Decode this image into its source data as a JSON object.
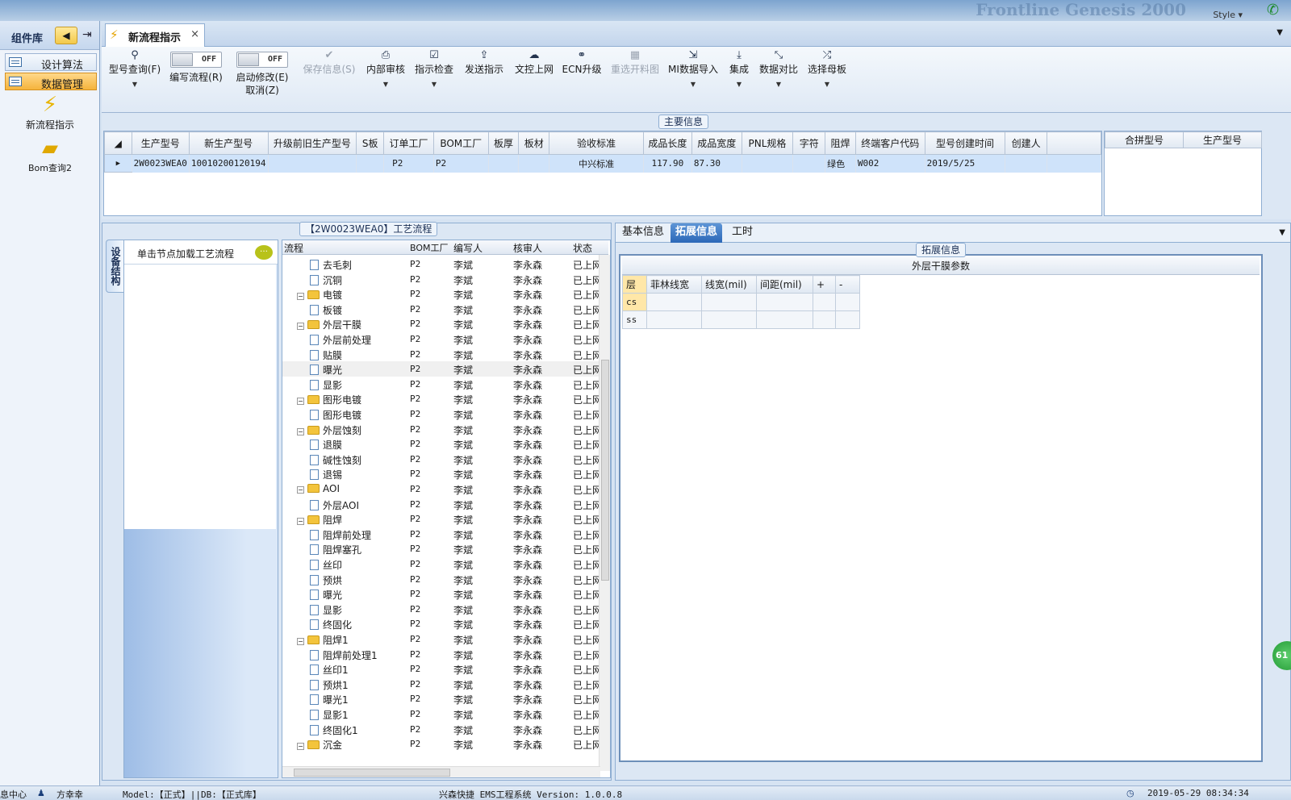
{
  "topstrip": {
    "brand": "Frontline  Genesis 2000",
    "style_label": "Style"
  },
  "left_panel": {
    "title": "组件库",
    "items": [
      {
        "label": "设计算法",
        "active": false
      },
      {
        "label": "数据管理",
        "active": true
      }
    ],
    "tools": [
      {
        "label": "新流程指示",
        "icon": "lightning-icon"
      },
      {
        "label": "Bom查询2",
        "icon": "folder-open-icon"
      }
    ]
  },
  "doc_tab": {
    "label": "新流程指示",
    "close": "×"
  },
  "ribbon": {
    "query": {
      "label": "型号查询(F)"
    },
    "write_flow": {
      "toggle": "OFF",
      "label": "编写流程(R)"
    },
    "start_edit": {
      "toggle": "OFF",
      "label": "启动修改(E)",
      "label2": "取消(Z)"
    },
    "buttons": [
      {
        "label": "保存信息(S)",
        "disabled": true
      },
      {
        "label": "内部审核",
        "disabled": false
      },
      {
        "label": "指示检查",
        "disabled": false
      },
      {
        "label": "发送指示",
        "disabled": false
      },
      {
        "label": "文控上网",
        "disabled": false
      },
      {
        "label": "ECN升级",
        "disabled": false
      },
      {
        "label": "重选开料图",
        "disabled": true
      },
      {
        "label": "MI数据导入",
        "disabled": false
      },
      {
        "label": "集成",
        "disabled": false
      },
      {
        "label": "数据对比",
        "disabled": false
      },
      {
        "label": "选择母板",
        "disabled": false
      }
    ]
  },
  "main_info": {
    "caption": "主要信息",
    "columns": [
      "生产型号",
      "新生产型号",
      "升级前旧生产型号",
      "S板",
      "订单工厂",
      "BOM工厂",
      "板厚",
      "板材",
      "验收标准",
      "成品长度",
      "成品宽度",
      "PNL规格",
      "字符",
      "阻焊",
      "终端客户代码",
      "型号创建时间",
      "创建人"
    ],
    "row": [
      "2W0023WEA0",
      "10010200120194",
      "",
      "",
      "P2",
      "P2",
      "",
      "",
      "中兴标准",
      "117.90",
      "87.30",
      "",
      "",
      "绿色",
      "W002",
      "2019/5/25",
      ""
    ],
    "side_columns": [
      "合拼型号",
      "生产型号"
    ]
  },
  "process": {
    "caption": "【2W0023WEA0】工艺流程",
    "vtab": "设备结构",
    "device_label": "单击节点加载工艺流程",
    "headers": [
      "流程",
      "BOM工厂",
      "编写人",
      "核审人",
      "状态"
    ],
    "rows": [
      {
        "name": "去毛刺",
        "level": 2,
        "folder": false,
        "bom": "P2",
        "writer": "李斌",
        "reviewer": "李永森",
        "status": "已上网"
      },
      {
        "name": "沉铜",
        "level": 2,
        "folder": false,
        "bom": "P2",
        "writer": "李斌",
        "reviewer": "李永森",
        "status": "已上网"
      },
      {
        "name": "电镀",
        "level": 1,
        "folder": true,
        "bom": "P2",
        "writer": "李斌",
        "reviewer": "李永森",
        "status": "已上网"
      },
      {
        "name": "板镀",
        "level": 2,
        "folder": false,
        "bom": "P2",
        "writer": "李斌",
        "reviewer": "李永森",
        "status": "已上网"
      },
      {
        "name": "外层干膜",
        "level": 1,
        "folder": true,
        "bom": "P2",
        "writer": "李斌",
        "reviewer": "李永森",
        "status": "已上网"
      },
      {
        "name": "外层前处理",
        "level": 2,
        "folder": false,
        "bom": "P2",
        "writer": "李斌",
        "reviewer": "李永森",
        "status": "已上网"
      },
      {
        "name": "贴膜",
        "level": 2,
        "folder": false,
        "bom": "P2",
        "writer": "李斌",
        "reviewer": "李永森",
        "status": "已上网"
      },
      {
        "name": "曝光",
        "level": 2,
        "folder": false,
        "bom": "P2",
        "writer": "李斌",
        "reviewer": "李永森",
        "status": "已上网",
        "highlight": true
      },
      {
        "name": "显影",
        "level": 2,
        "folder": false,
        "bom": "P2",
        "writer": "李斌",
        "reviewer": "李永森",
        "status": "已上网"
      },
      {
        "name": "图形电镀",
        "level": 1,
        "folder": true,
        "bom": "P2",
        "writer": "李斌",
        "reviewer": "李永森",
        "status": "已上网"
      },
      {
        "name": "图形电镀",
        "level": 2,
        "folder": false,
        "bom": "P2",
        "writer": "李斌",
        "reviewer": "李永森",
        "status": "已上网"
      },
      {
        "name": "外层蚀刻",
        "level": 1,
        "folder": true,
        "bom": "P2",
        "writer": "李斌",
        "reviewer": "李永森",
        "status": "已上网"
      },
      {
        "name": "退膜",
        "level": 2,
        "folder": false,
        "bom": "P2",
        "writer": "李斌",
        "reviewer": "李永森",
        "status": "已上网"
      },
      {
        "name": "碱性蚀刻",
        "level": 2,
        "folder": false,
        "bom": "P2",
        "writer": "李斌",
        "reviewer": "李永森",
        "status": "已上网"
      },
      {
        "name": "退锡",
        "level": 2,
        "folder": false,
        "bom": "P2",
        "writer": "李斌",
        "reviewer": "李永森",
        "status": "已上网"
      },
      {
        "name": "AOI",
        "level": 1,
        "folder": true,
        "bom": "P2",
        "writer": "李斌",
        "reviewer": "李永森",
        "status": "已上网"
      },
      {
        "name": "外层AOI",
        "level": 2,
        "folder": false,
        "bom": "P2",
        "writer": "李斌",
        "reviewer": "李永森",
        "status": "已上网"
      },
      {
        "name": "阻焊",
        "level": 1,
        "folder": true,
        "bom": "P2",
        "writer": "李斌",
        "reviewer": "李永森",
        "status": "已上网"
      },
      {
        "name": "阻焊前处理",
        "level": 2,
        "folder": false,
        "bom": "P2",
        "writer": "李斌",
        "reviewer": "李永森",
        "status": "已上网"
      },
      {
        "name": "阻焊塞孔",
        "level": 2,
        "folder": false,
        "bom": "P2",
        "writer": "李斌",
        "reviewer": "李永森",
        "status": "已上网"
      },
      {
        "name": "丝印",
        "level": 2,
        "folder": false,
        "bom": "P2",
        "writer": "李斌",
        "reviewer": "李永森",
        "status": "已上网"
      },
      {
        "name": "预烘",
        "level": 2,
        "folder": false,
        "bom": "P2",
        "writer": "李斌",
        "reviewer": "李永森",
        "status": "已上网"
      },
      {
        "name": "曝光",
        "level": 2,
        "folder": false,
        "bom": "P2",
        "writer": "李斌",
        "reviewer": "李永森",
        "status": "已上网"
      },
      {
        "name": "显影",
        "level": 2,
        "folder": false,
        "bom": "P2",
        "writer": "李斌",
        "reviewer": "李永森",
        "status": "已上网"
      },
      {
        "name": "终固化",
        "level": 2,
        "folder": false,
        "bom": "P2",
        "writer": "李斌",
        "reviewer": "李永森",
        "status": "已上网"
      },
      {
        "name": "阻焊1",
        "level": 1,
        "folder": true,
        "bom": "P2",
        "writer": "李斌",
        "reviewer": "李永森",
        "status": "已上网"
      },
      {
        "name": "阻焊前处理1",
        "level": 2,
        "folder": false,
        "bom": "P2",
        "writer": "李斌",
        "reviewer": "李永森",
        "status": "已上网"
      },
      {
        "name": "丝印1",
        "level": 2,
        "folder": false,
        "bom": "P2",
        "writer": "李斌",
        "reviewer": "李永森",
        "status": "已上网"
      },
      {
        "name": "预烘1",
        "level": 2,
        "folder": false,
        "bom": "P2",
        "writer": "李斌",
        "reviewer": "李永森",
        "status": "已上网"
      },
      {
        "name": "曝光1",
        "level": 2,
        "folder": false,
        "bom": "P2",
        "writer": "李斌",
        "reviewer": "李永森",
        "status": "已上网"
      },
      {
        "name": "显影1",
        "level": 2,
        "folder": false,
        "bom": "P2",
        "writer": "李斌",
        "reviewer": "李永森",
        "status": "已上网"
      },
      {
        "name": "终固化1",
        "level": 2,
        "folder": false,
        "bom": "P2",
        "writer": "李斌",
        "reviewer": "李永森",
        "status": "已上网"
      },
      {
        "name": "沉金",
        "level": 1,
        "folder": true,
        "bom": "P2",
        "writer": "李斌",
        "reviewer": "李永森",
        "status": "已上网"
      }
    ]
  },
  "right_panel": {
    "tabs": [
      {
        "label": "基本信息",
        "active": false
      },
      {
        "label": "拓展信息",
        "active": true
      },
      {
        "label": "工时",
        "active": false
      }
    ],
    "caption": "拓展信息",
    "table_title": "外层干膜参数",
    "headers": [
      "层",
      "菲林线宽",
      "线宽(mil)",
      "间距(mil)",
      "+",
      "-"
    ],
    "rows": [
      {
        "layer": "cs",
        "film": "",
        "width": "",
        "spacing": ""
      },
      {
        "layer": "ss",
        "film": "",
        "width": "",
        "spacing": ""
      }
    ],
    "badge": "61"
  },
  "statusbar": {
    "left": "息中心",
    "user": "方幸幸",
    "model": "Model:【正式】||DB:【正式库】",
    "system": "兴森快捷 EMS工程系统 Version: 1.0.0.8",
    "datetime": "2019-05-29 08:34:34"
  },
  "colors": {
    "accent": "#2c68b8",
    "active_orange": "#f5b43c",
    "frame": "#8faed2"
  }
}
